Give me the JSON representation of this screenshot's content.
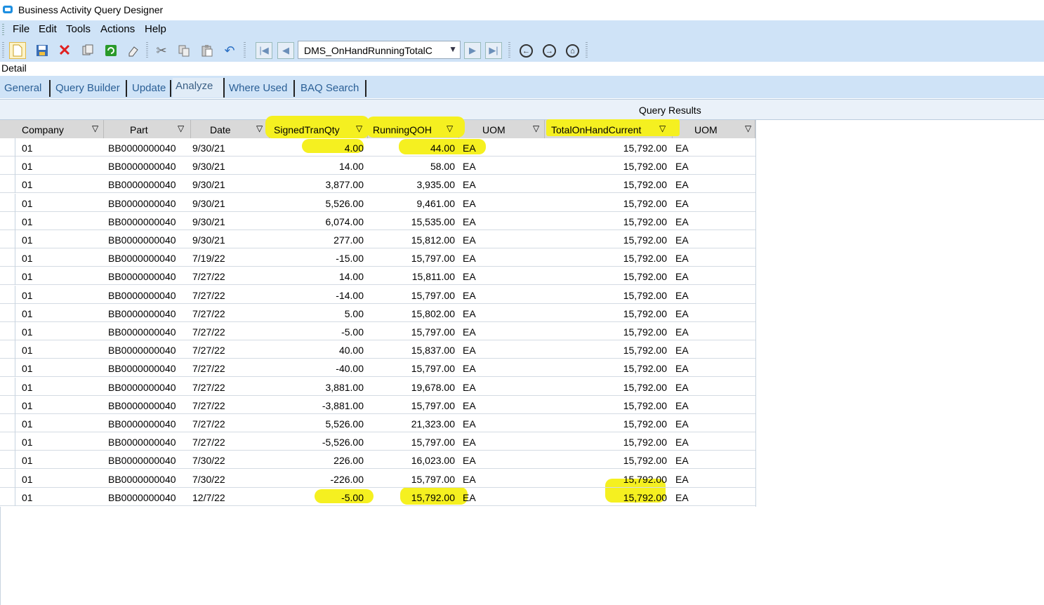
{
  "window": {
    "title": "Business Activity Query Designer"
  },
  "menu": [
    "File",
    "Edit",
    "Tools",
    "Actions",
    "Help"
  ],
  "toolbar": {
    "query_selector_value": "DMS_OnHandRunningTotalC",
    "icons": [
      "new-icon",
      "save-icon",
      "delete-icon",
      "copy-icon",
      "refresh-icon",
      "clear-icon",
      "cut-icon",
      "copy2-icon",
      "paste-icon",
      "undo-icon",
      "first-record-icon",
      "prev-record-icon",
      "next-record-icon",
      "last-record-icon",
      "back-icon",
      "forward-icon",
      "home-icon"
    ]
  },
  "detail_label": "Detail",
  "tabs": [
    "General",
    "Query Builder",
    "Update",
    "Analyze",
    "Where Used",
    "BAQ Search"
  ],
  "active_tab": "Analyze",
  "query_results": {
    "title": "Query Results",
    "columns": [
      "Company",
      "Part",
      "Date",
      "SignedTranQty",
      "RunningQOH",
      "UOM",
      "TotalOnHandCurrent",
      "UOM"
    ],
    "rows": [
      [
        "01",
        "BB0000000040",
        "9/30/21",
        "4.00",
        "44.00",
        "EA",
        "15,792.00",
        "EA"
      ],
      [
        "01",
        "BB0000000040",
        "9/30/21",
        "14.00",
        "58.00",
        "EA",
        "15,792.00",
        "EA"
      ],
      [
        "01",
        "BB0000000040",
        "9/30/21",
        "3,877.00",
        "3,935.00",
        "EA",
        "15,792.00",
        "EA"
      ],
      [
        "01",
        "BB0000000040",
        "9/30/21",
        "5,526.00",
        "9,461.00",
        "EA",
        "15,792.00",
        "EA"
      ],
      [
        "01",
        "BB0000000040",
        "9/30/21",
        "6,074.00",
        "15,535.00",
        "EA",
        "15,792.00",
        "EA"
      ],
      [
        "01",
        "BB0000000040",
        "9/30/21",
        "277.00",
        "15,812.00",
        "EA",
        "15,792.00",
        "EA"
      ],
      [
        "01",
        "BB0000000040",
        "7/19/22",
        "-15.00",
        "15,797.00",
        "EA",
        "15,792.00",
        "EA"
      ],
      [
        "01",
        "BB0000000040",
        "7/27/22",
        "14.00",
        "15,811.00",
        "EA",
        "15,792.00",
        "EA"
      ],
      [
        "01",
        "BB0000000040",
        "7/27/22",
        "-14.00",
        "15,797.00",
        "EA",
        "15,792.00",
        "EA"
      ],
      [
        "01",
        "BB0000000040",
        "7/27/22",
        "5.00",
        "15,802.00",
        "EA",
        "15,792.00",
        "EA"
      ],
      [
        "01",
        "BB0000000040",
        "7/27/22",
        "-5.00",
        "15,797.00",
        "EA",
        "15,792.00",
        "EA"
      ],
      [
        "01",
        "BB0000000040",
        "7/27/22",
        "40.00",
        "15,837.00",
        "EA",
        "15,792.00",
        "EA"
      ],
      [
        "01",
        "BB0000000040",
        "7/27/22",
        "-40.00",
        "15,797.00",
        "EA",
        "15,792.00",
        "EA"
      ],
      [
        "01",
        "BB0000000040",
        "7/27/22",
        "3,881.00",
        "19,678.00",
        "EA",
        "15,792.00",
        "EA"
      ],
      [
        "01",
        "BB0000000040",
        "7/27/22",
        "-3,881.00",
        "15,797.00",
        "EA",
        "15,792.00",
        "EA"
      ],
      [
        "01",
        "BB0000000040",
        "7/27/22",
        "5,526.00",
        "21,323.00",
        "EA",
        "15,792.00",
        "EA"
      ],
      [
        "01",
        "BB0000000040",
        "7/27/22",
        "-5,526.00",
        "15,797.00",
        "EA",
        "15,792.00",
        "EA"
      ],
      [
        "01",
        "BB0000000040",
        "7/30/22",
        "226.00",
        "16,023.00",
        "EA",
        "15,792.00",
        "EA"
      ],
      [
        "01",
        "BB0000000040",
        "7/30/22",
        "-226.00",
        "15,797.00",
        "EA",
        "15,792.00",
        "EA"
      ],
      [
        "01",
        "BB0000000040",
        "12/7/22",
        "-5.00",
        "15,792.00",
        "EA",
        "15,792.00",
        "EA"
      ]
    ]
  },
  "highlight_color": "#f5f020"
}
